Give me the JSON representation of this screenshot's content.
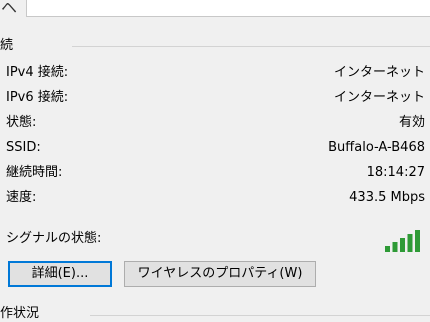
{
  "top": {
    "glyph": "ヘ"
  },
  "connection_group": {
    "title": "続"
  },
  "rows": [
    {
      "label": "IPv4 接続:",
      "value": "インターネット"
    },
    {
      "label": "IPv6 接続:",
      "value": "インターネット"
    },
    {
      "label": "状態:",
      "value": "有効"
    },
    {
      "label": "SSID:",
      "value": "Buffalo-A-B468"
    },
    {
      "label": "継続時間:",
      "value": "18:14:27"
    },
    {
      "label": "速度:",
      "value": "433.5 Mbps"
    }
  ],
  "signal": {
    "label": "シグナルの状態:",
    "bars": 5,
    "bars_filled": 5,
    "color": "#2e9a36"
  },
  "buttons": {
    "details_label": "詳細(E)...",
    "wireless_properties_label": "ワイヤレスのプロパティ(W)"
  },
  "activity_group": {
    "title": "作状況"
  },
  "colors": {
    "default_button_border": "#0078d7",
    "background": "#f0f0f0"
  }
}
